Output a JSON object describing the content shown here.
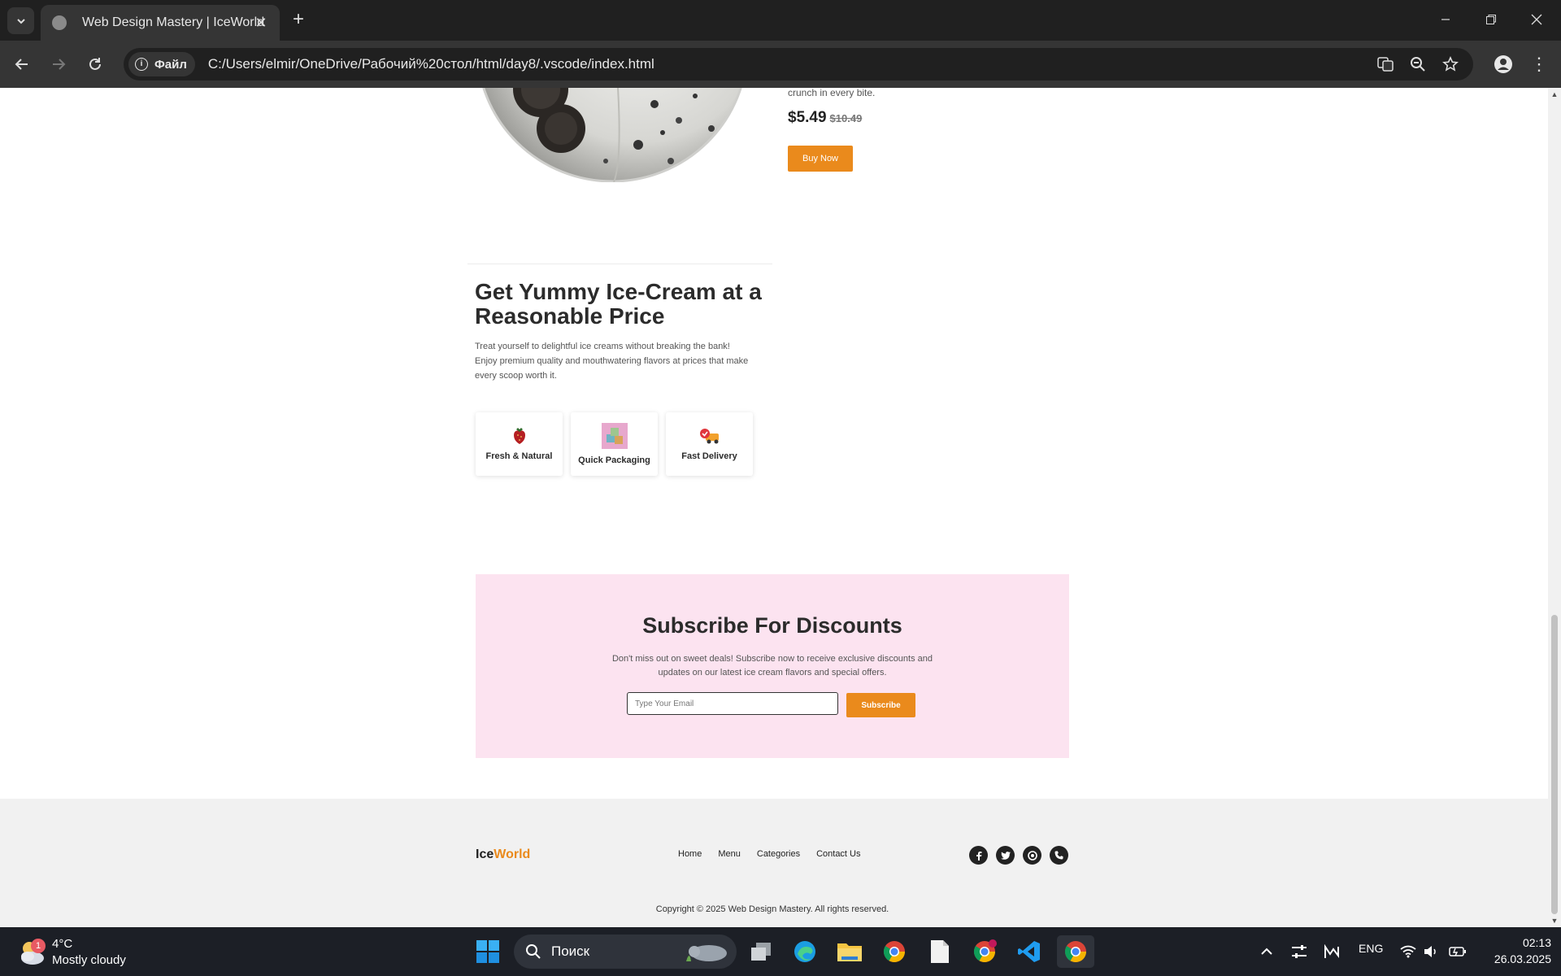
{
  "browser": {
    "tab_title": "Web Design Mastery | IceWorld",
    "site_chip_label": "Файл",
    "url": "C:/Users/elmir/OneDrive/Рабочий%20стол/html/day8/.vscode/index.html"
  },
  "product": {
    "description_tail": "crunch in every bite.",
    "price": "$5.49",
    "old_price": "$10.49",
    "buy_label": "Buy Now"
  },
  "pricing_section": {
    "title": "Get Yummy Ice-Cream at a Reasonable Price",
    "text": "Treat yourself to delightful ice creams without breaking the bank! Enjoy premium quality and mouthwatering flavors at prices that make every scoop worth it.",
    "features": [
      {
        "label": "Fresh & Natural",
        "icon": "strawberry-icon"
      },
      {
        "label": "Quick Packaging",
        "icon": "package-icon"
      },
      {
        "label": "Fast Delivery",
        "icon": "delivery-icon"
      }
    ]
  },
  "subscribe": {
    "title": "Subscribe For Discounts",
    "text": "Don't miss out on sweet deals! Subscribe now to receive exclusive discounts and updates on our latest ice cream flavors and special offers.",
    "email_placeholder": "Type Your Email",
    "button_label": "Subscribe"
  },
  "footer": {
    "logo_part1": "Ice",
    "logo_part2": "World",
    "nav": [
      "Home",
      "Menu",
      "Categories",
      "Contact Us"
    ],
    "socials": [
      "facebook-icon",
      "twitter-icon",
      "pinterest-icon",
      "phone-icon"
    ],
    "copyright": "Copyright © 2025 Web Design Mastery. All rights reserved."
  },
  "taskbar": {
    "weather_badge": "1",
    "temperature": "4°C",
    "condition": "Mostly cloudy",
    "search_placeholder": "Поиск",
    "language": "ENG",
    "time": "02:13",
    "date": "26.03.2025"
  },
  "colors": {
    "accent": "#ea8a1c",
    "subscribe_bg": "#fce3f0",
    "footer_bg": "#f1f1f1",
    "chrome_dark": "#202020",
    "chrome_toolbar": "#353535"
  }
}
